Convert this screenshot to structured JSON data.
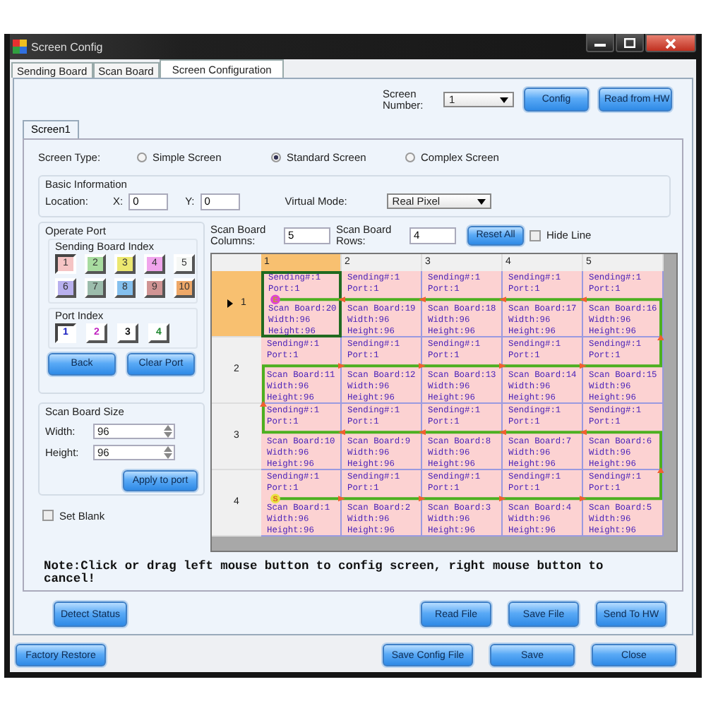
{
  "window": {
    "title": "Screen Config"
  },
  "tabs": [
    {
      "label": "Sending Board",
      "selected": false
    },
    {
      "label": "Scan Board",
      "selected": false
    },
    {
      "label": "Screen Configuration",
      "selected": true
    }
  ],
  "screen_number": {
    "label": "Screen Number:",
    "value": "1"
  },
  "top_buttons": [
    "Config",
    "Read from HW"
  ],
  "screen_tabs": [
    {
      "label": "Screen1",
      "selected": true
    }
  ],
  "screen_type": {
    "label": "Screen Type:",
    "options": [
      {
        "label": "Simple Screen",
        "selected": false
      },
      {
        "label": "Standard Screen",
        "selected": true
      },
      {
        "label": "Complex Screen",
        "selected": false
      }
    ]
  },
  "basic_info": {
    "title": "Basic Information",
    "location_label": "Location:",
    "x_label": "X:",
    "x_value": "0",
    "y_label": "Y:",
    "y_value": "0",
    "virtual_mode_label": "Virtual Mode:",
    "virtual_mode_value": "Real Pixel"
  },
  "operate_port": {
    "title": "Operate Port",
    "sending_board_index": {
      "title": "Sending Board Index",
      "items": [
        {
          "label": "1",
          "color": "#f5c4c4",
          "selected": true
        },
        {
          "label": "2",
          "color": "#a8dca0",
          "selected": false
        },
        {
          "label": "3",
          "color": "#ece870",
          "selected": false
        },
        {
          "label": "4",
          "color": "#f0a4ec",
          "selected": false
        },
        {
          "label": "5",
          "color": "#f6f8f6",
          "selected": false
        },
        {
          "label": "6",
          "color": "#b8b0ee",
          "selected": false
        },
        {
          "label": "7",
          "color": "#9cbcac",
          "selected": false
        },
        {
          "label": "8",
          "color": "#84c0ee",
          "selected": false
        },
        {
          "label": "9",
          "color": "#d09494",
          "selected": false
        },
        {
          "label": "10",
          "color": "#eea868",
          "selected": false
        }
      ]
    },
    "port_index": {
      "title": "Port Index",
      "items": [
        {
          "label": "1",
          "color": "#1a20c0",
          "selected": true
        },
        {
          "label": "2",
          "color": "#c020c0",
          "selected": false
        },
        {
          "label": "3",
          "color": "#101010",
          "selected": false
        },
        {
          "label": "4",
          "color": "#208830",
          "selected": false
        }
      ]
    },
    "buttons": [
      "Back",
      "Clear Port"
    ]
  },
  "scan_board_size": {
    "title": "Scan Board Size",
    "width_label": "Width:",
    "width_value": "96",
    "height_label": "Height:",
    "height_value": "96",
    "apply_button": "Apply to port"
  },
  "set_blank": {
    "label": "Set Blank",
    "checked": false
  },
  "grid_controls": {
    "columns_label": "Scan Board Columns:",
    "columns_value": "5",
    "rows_label": "Scan Board Rows:",
    "rows_value": "4",
    "reset_button": "Reset All",
    "hide_line": {
      "label": "Hide Line",
      "checked": false
    }
  },
  "grid": {
    "columns": [
      {
        "label": "1",
        "selected": true
      },
      {
        "label": "2",
        "selected": false
      },
      {
        "label": "3",
        "selected": false
      },
      {
        "label": "4",
        "selected": false
      },
      {
        "label": "5",
        "selected": false
      }
    ],
    "rows": [
      {
        "label": "1",
        "selected": true,
        "cells": [
          {
            "lines": [
              "Sending#:1",
              "Port:1",
              "Scan Board:20",
              "Width:96",
              "Height:96"
            ],
            "selected": true,
            "marker": {
              "kind": "end",
              "label": "E"
            }
          },
          {
            "lines": [
              "Sending#:1",
              "Port:1",
              "Scan Board:19",
              "Width:96",
              "Height:96"
            ],
            "selected": false
          },
          {
            "lines": [
              "Sending#:1",
              "Port:1",
              "Scan Board:18",
              "Width:96",
              "Height:96"
            ],
            "selected": false
          },
          {
            "lines": [
              "Sending#:1",
              "Port:1",
              "Scan Board:17",
              "Width:96",
              "Height:96"
            ],
            "selected": false
          },
          {
            "lines": [
              "Sending#:1",
              "Port:1",
              "Scan Board:16",
              "Width:96",
              "Height:96"
            ],
            "selected": false
          }
        ]
      },
      {
        "label": "2",
        "selected": false,
        "cells": [
          {
            "lines": [
              "Sending#:1",
              "Port:1",
              "Scan Board:11",
              "Width:96",
              "Height:96"
            ],
            "selected": false
          },
          {
            "lines": [
              "Sending#:1",
              "Port:1",
              "Scan Board:12",
              "Width:96",
              "Height:96"
            ],
            "selected": false
          },
          {
            "lines": [
              "Sending#:1",
              "Port:1",
              "Scan Board:13",
              "Width:96",
              "Height:96"
            ],
            "selected": false
          },
          {
            "lines": [
              "Sending#:1",
              "Port:1",
              "Scan Board:14",
              "Width:96",
              "Height:96"
            ],
            "selected": false
          },
          {
            "lines": [
              "Sending#:1",
              "Port:1",
              "Scan Board:15",
              "Width:96",
              "Height:96"
            ],
            "selected": false
          }
        ]
      },
      {
        "label": "3",
        "selected": false,
        "cells": [
          {
            "lines": [
              "Sending#:1",
              "Port:1",
              "Scan Board:10",
              "Width:96",
              "Height:96"
            ],
            "selected": false
          },
          {
            "lines": [
              "Sending#:1",
              "Port:1",
              "Scan Board:9",
              "Width:96",
              "Height:96"
            ],
            "selected": false
          },
          {
            "lines": [
              "Sending#:1",
              "Port:1",
              "Scan Board:8",
              "Width:96",
              "Height:96"
            ],
            "selected": false
          },
          {
            "lines": [
              "Sending#:1",
              "Port:1",
              "Scan Board:7",
              "Width:96",
              "Height:96"
            ],
            "selected": false
          },
          {
            "lines": [
              "Sending#:1",
              "Port:1",
              "Scan Board:6",
              "Width:96",
              "Height:96"
            ],
            "selected": false
          }
        ]
      },
      {
        "label": "4",
        "selected": false,
        "cells": [
          {
            "lines": [
              "Sending#:1",
              "Port:1",
              "Scan Board:1",
              "Width:96",
              "Height:96"
            ],
            "selected": false,
            "marker": {
              "kind": "start",
              "label": "S"
            }
          },
          {
            "lines": [
              "Sending#:1",
              "Port:1",
              "Scan Board:2",
              "Width:96",
              "Height:96"
            ],
            "selected": false
          },
          {
            "lines": [
              "Sending#:1",
              "Port:1",
              "Scan Board:3",
              "Width:96",
              "Height:96"
            ],
            "selected": false
          },
          {
            "lines": [
              "Sending#:1",
              "Port:1",
              "Scan Board:4",
              "Width:96",
              "Height:96"
            ],
            "selected": false
          },
          {
            "lines": [
              "Sending#:1",
              "Port:1",
              "Scan Board:5",
              "Width:96",
              "Height:96"
            ],
            "selected": false
          }
        ]
      }
    ]
  },
  "note": "Note:Click or drag left mouse button to config screen, right mouse button to cancel!",
  "action_buttons": [
    "Detect Status",
    "Read File",
    "Save File",
    "Send To HW"
  ],
  "footer_buttons": [
    "Factory Restore",
    "Save Config File",
    "Save",
    "Close"
  ]
}
